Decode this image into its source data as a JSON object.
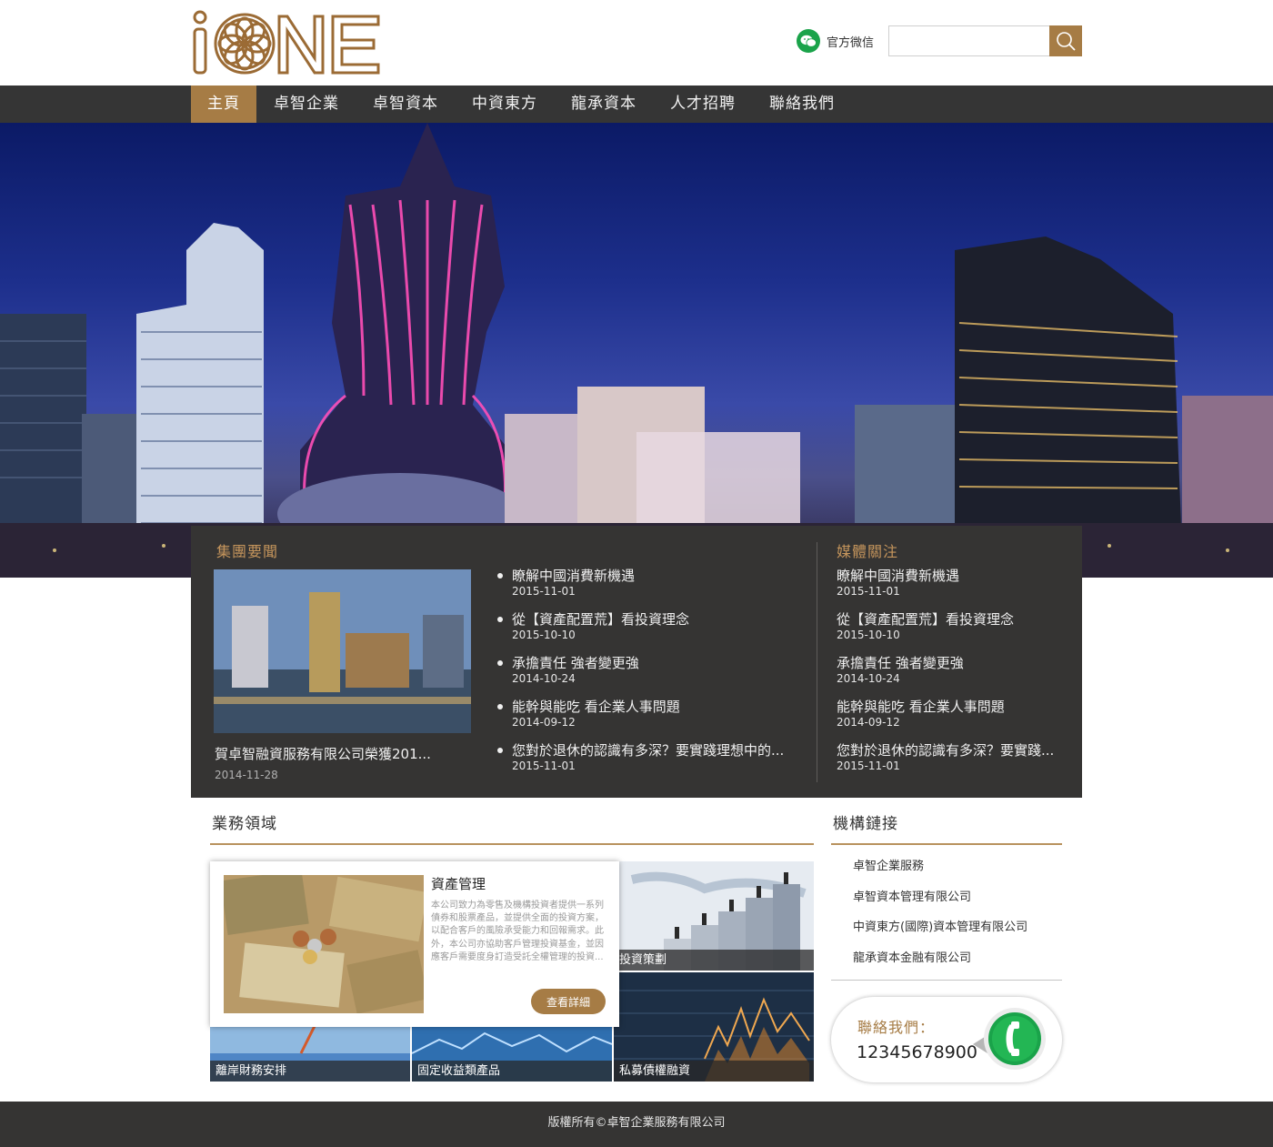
{
  "brand": {
    "logo_text": "iONE",
    "accent_color": "#a67c45",
    "logo_color": "#9b6b35"
  },
  "header": {
    "wechat_label": "官方微信",
    "wechat_icon": "wechat-icon",
    "search_placeholder": "",
    "search_icon": "search-icon"
  },
  "nav": {
    "items": [
      "主頁",
      "卓智企業",
      "卓智資本",
      "中資東方",
      "龍承資本",
      "人才招聘",
      "聯絡我們"
    ],
    "active_index": 0
  },
  "news": {
    "group_title": "集團要聞",
    "featured": {
      "title": "賀卓智融資服務有限公司榮獲201...",
      "date": "2014-11-28"
    },
    "group_items": [
      {
        "title": "瞭解中國消費新機遇",
        "date": "2015-11-01"
      },
      {
        "title": "從【資產配置荒】看投資理念",
        "date": "2015-10-10"
      },
      {
        "title": "承擔責任 強者變更強",
        "date": "2014-10-24"
      },
      {
        "title": "能幹與能吃 看企業人事問題",
        "date": "2014-09-12"
      },
      {
        "title": "您對於退休的認識有多深？要實踐理想中的...",
        "date": "2015-11-01"
      }
    ],
    "media_title": "媒體關注",
    "media_items": [
      {
        "title": "瞭解中國消費新機遇",
        "date": "2015-11-01"
      },
      {
        "title": "從【資產配置荒】看投資理念",
        "date": "2015-10-10"
      },
      {
        "title": "承擔責任 強者變更強",
        "date": "2014-10-24"
      },
      {
        "title": "能幹與能吃 看企業人事問題",
        "date": "2014-09-12"
      },
      {
        "title": "您對於退休的認識有多深？要實踐...",
        "date": "2015-11-01"
      }
    ]
  },
  "business": {
    "title": "業務領域",
    "featured": {
      "title": "資產管理",
      "desc": "本公司致力為零售及機構投資者提供一系列債券和股票產品，並提供全面的投資方案，以配合客戶的風險承受能力和回報需求。此外，本公司亦協助客戶管理投資基金，並因應客戶需要度身訂造受託全權管理的投資...",
      "button": "查看詳細"
    },
    "tiles": [
      "投資策劃",
      "離岸財務安排",
      "固定收益類產品",
      "私募債權融資"
    ]
  },
  "links": {
    "title": "機構鏈接",
    "items": [
      "卓智企業服務",
      "卓智資本管理有限公司",
      "中資東方(國際)資本管理有限公司",
      "龍承資本金融有限公司"
    ]
  },
  "contact": {
    "title": "聯絡我們：",
    "phone": "12345678900",
    "icon": "phone-icon"
  },
  "footer": {
    "copyright": "版權所有©卓智企業服務有限公司"
  }
}
